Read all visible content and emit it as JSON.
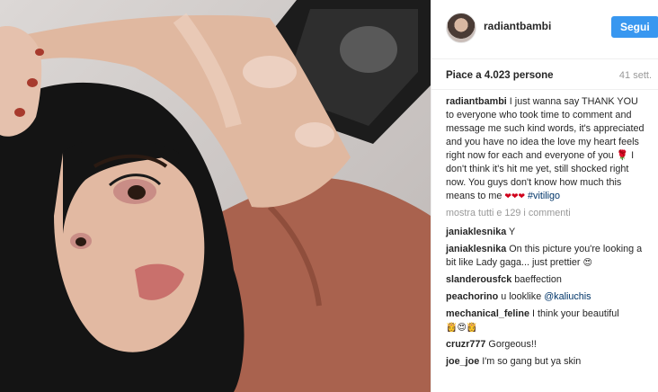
{
  "post": {
    "username": "radiantbambi",
    "follow_label": "Segui",
    "likes": "Piace a 4.023 persone",
    "time": "41 sett."
  },
  "caption": {
    "author": "radiantbambi",
    "text": "I just wanna say THANK YOU to everyone who took time to comment and message me such kind words, it's appreciated and you have no idea the love my heart feels right now for each and everyone of you 🌹 I don't think it's hit me yet, still shocked right now. You guys don't know how much this means to me",
    "hearts": "❤❤❤",
    "hashtag": "#vitiligo"
  },
  "load_more": "mostra tutti e 129 i commenti",
  "comments": [
    {
      "author": "janiaklesnika",
      "text": "Y"
    },
    {
      "author": "janiaklesnika",
      "text": "On this picture you're looking a bit like Lady gaga... just prettier",
      "emoji": "😍"
    },
    {
      "author": "slanderousfck",
      "text": "baeffection"
    },
    {
      "author": "peachorino",
      "text": "u looklike",
      "mention": "@kaliuchis"
    },
    {
      "author": "mechanical_feline",
      "text": "I think your beautiful",
      "emoji": "👸😍👸"
    },
    {
      "author": "cruzr777",
      "text": "Gorgeous!!"
    },
    {
      "author": "joe_joe",
      "text": "I'm so gang but ya skin"
    }
  ],
  "colors": {
    "follow_button": "#3897f0",
    "link": "#003569",
    "muted": "#999999"
  }
}
